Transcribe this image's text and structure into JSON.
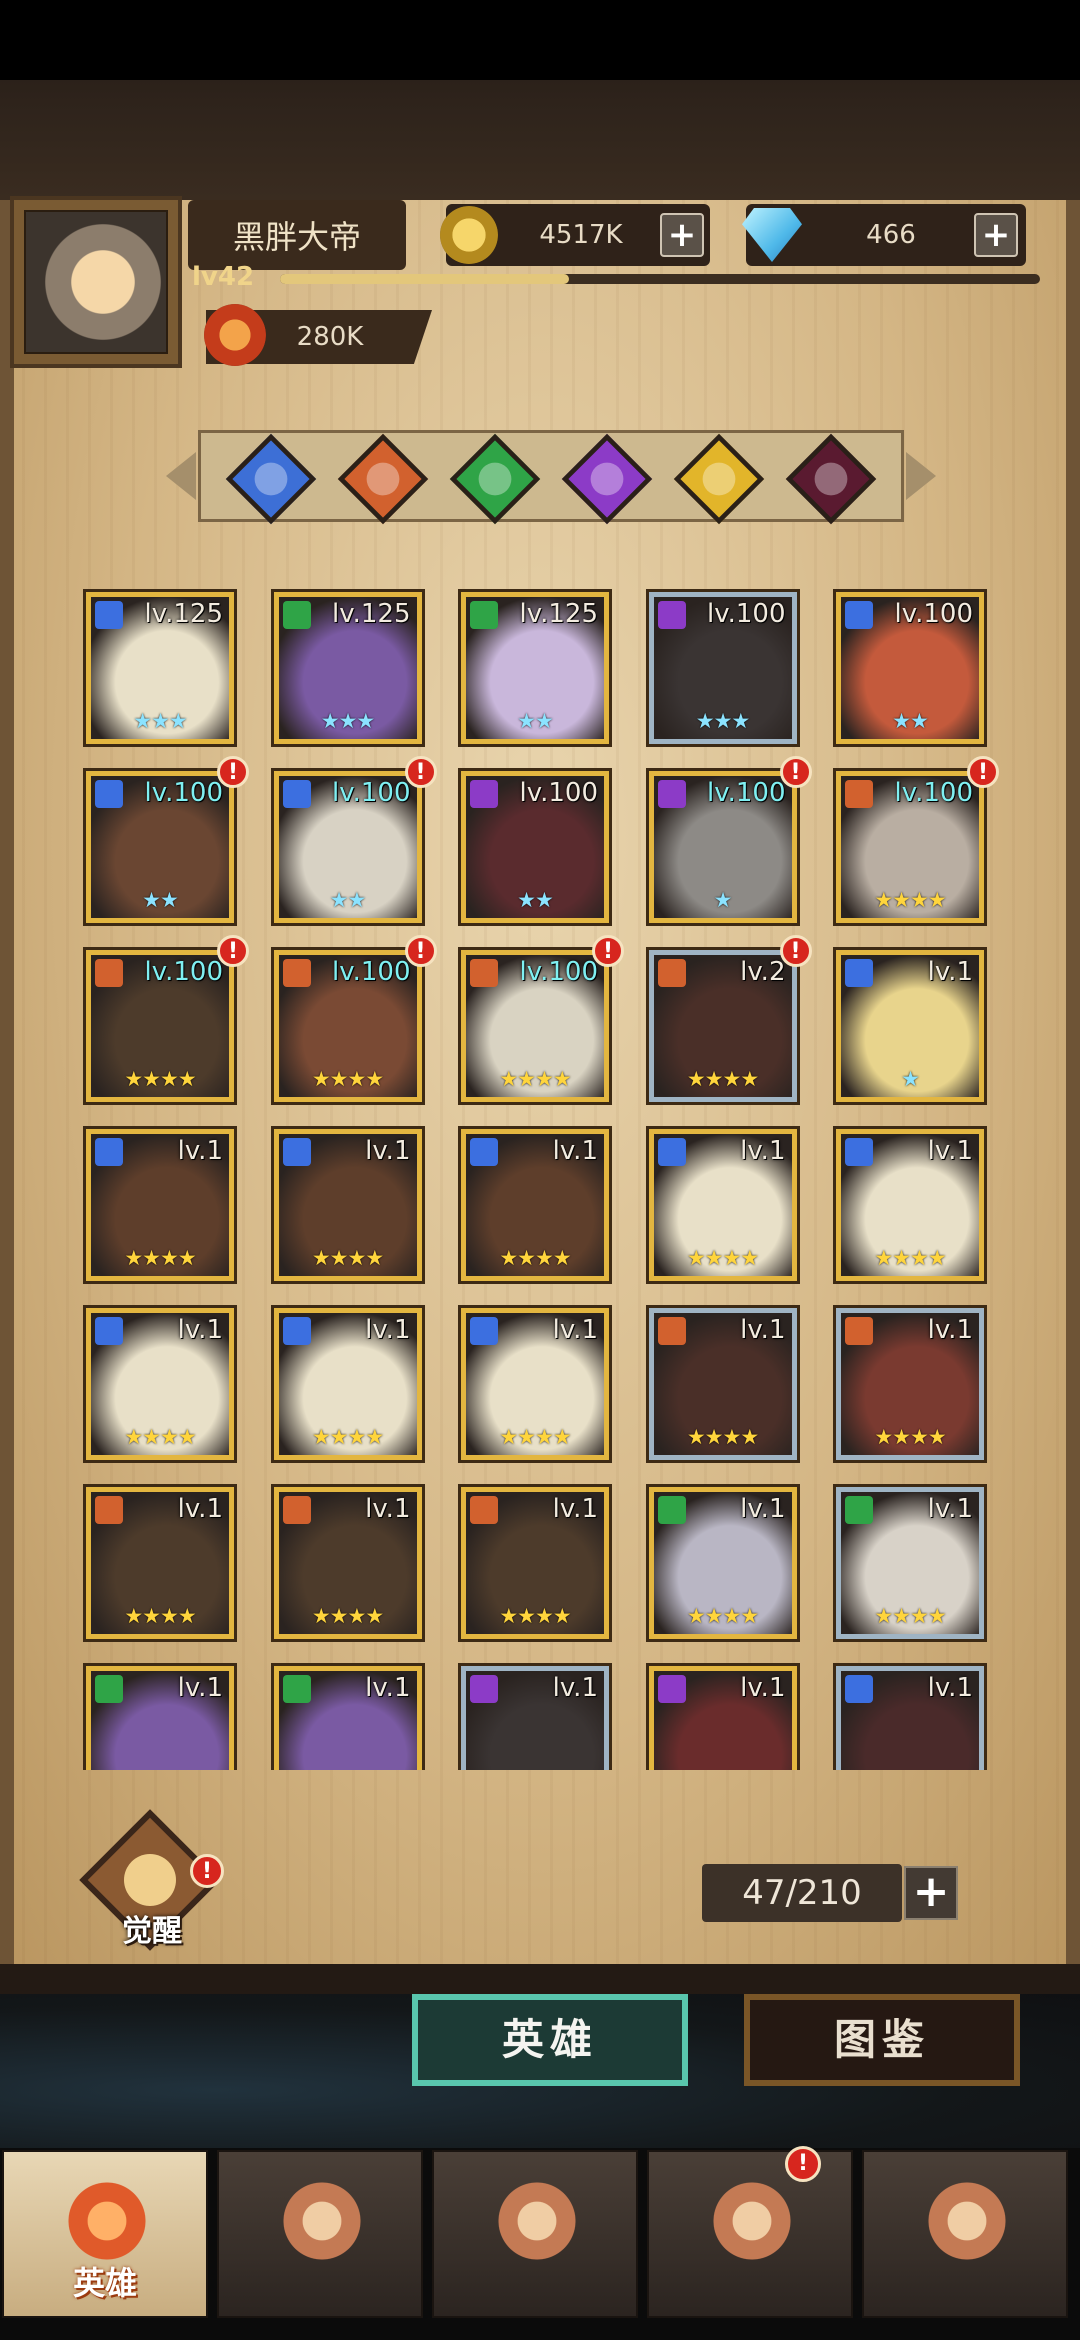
{
  "player": {
    "name": "黑胖大帝",
    "level": "lv42",
    "gold": "4517K",
    "diamonds": "466",
    "power": "280K",
    "xp_progress": 0.38
  },
  "factions": [
    {
      "icon": "faction-light-icon",
      "color": "#3d6fd6"
    },
    {
      "icon": "faction-fire-icon",
      "color": "#d2612e"
    },
    {
      "icon": "faction-nature-icon",
      "color": "#2fa447"
    },
    {
      "icon": "faction-arcane-icon",
      "color": "#8c3bc7"
    },
    {
      "icon": "faction-sun-icon",
      "color": "#e2b52a"
    },
    {
      "icon": "faction-dark-icon",
      "color": "#5a1a30"
    }
  ],
  "heroes": [
    {
      "lv": "lv.125",
      "stars": "★★★",
      "star_color": "blue",
      "frame": "gold",
      "class_color": "#3c6fe0",
      "portrait": "#e8e0c8",
      "capped": false,
      "alert": false
    },
    {
      "lv": "lv.125",
      "stars": "★★★",
      "star_color": "blue",
      "frame": "gold",
      "class_color": "#2fa447",
      "portrait": "#7a5aa3",
      "capped": false,
      "alert": false
    },
    {
      "lv": "lv.125",
      "stars": "★★",
      "star_color": "blue",
      "frame": "gold",
      "class_color": "#2fa447",
      "portrait": "#c9b7db",
      "capped": false,
      "alert": false
    },
    {
      "lv": "lv.100",
      "stars": "★★★",
      "star_color": "blue",
      "frame": "silver",
      "class_color": "#8c3bc7",
      "portrait": "#3a3433",
      "capped": false,
      "alert": false
    },
    {
      "lv": "lv.100",
      "stars": "★★",
      "star_color": "blue",
      "frame": "gold",
      "class_color": "#3c6fe0",
      "portrait": "#c45a3c",
      "capped": false,
      "alert": false
    },
    {
      "lv": "lv.100",
      "stars": "★★",
      "star_color": "blue",
      "frame": "gold",
      "class_color": "#3c6fe0",
      "portrait": "#6a4632",
      "capped": true,
      "alert": true
    },
    {
      "lv": "lv.100",
      "stars": "★★",
      "star_color": "blue",
      "frame": "gold",
      "class_color": "#3c6fe0",
      "portrait": "#d8d2c4",
      "capped": true,
      "alert": true
    },
    {
      "lv": "lv.100",
      "stars": "★★",
      "star_color": "blue",
      "frame": "gold",
      "class_color": "#8c3bc7",
      "portrait": "#5a2b2e",
      "capped": false,
      "alert": false
    },
    {
      "lv": "lv.100",
      "stars": "★",
      "star_color": "blue",
      "frame": "gold",
      "class_color": "#8c3bc7",
      "portrait": "#8d8a86",
      "capped": true,
      "alert": true
    },
    {
      "lv": "lv.100",
      "stars": "★★★★",
      "star_color": "gold",
      "frame": "gold",
      "class_color": "#d2612e",
      "portrait": "#b9aea2",
      "capped": true,
      "alert": true
    },
    {
      "lv": "lv.100",
      "stars": "★★★★",
      "star_color": "gold",
      "frame": "gold",
      "class_color": "#d2612e",
      "portrait": "#4d3b2b",
      "capped": true,
      "alert": true
    },
    {
      "lv": "lv.100",
      "stars": "★★★★",
      "star_color": "gold",
      "frame": "gold",
      "class_color": "#d2612e",
      "portrait": "#7a4a34",
      "capped": true,
      "alert": true
    },
    {
      "lv": "lv.100",
      "stars": "★★★★",
      "star_color": "gold",
      "frame": "gold",
      "class_color": "#d2612e",
      "portrait": "#d9d3c2",
      "capped": true,
      "alert": true
    },
    {
      "lv": "lv.2",
      "stars": "★★★★",
      "star_color": "gold",
      "frame": "silver",
      "class_color": "#d2612e",
      "portrait": "#4a2f28",
      "capped": false,
      "alert": true
    },
    {
      "lv": "lv.1",
      "stars": "★",
      "star_color": "blue",
      "frame": "gold",
      "class_color": "#3c6fe0",
      "portrait": "#e8d48c",
      "capped": false,
      "alert": false
    },
    {
      "lv": "lv.1",
      "stars": "★★★★",
      "star_color": "gold",
      "frame": "gold",
      "class_color": "#3c6fe0",
      "portrait": "#5e3e2b",
      "capped": false,
      "alert": false
    },
    {
      "lv": "lv.1",
      "stars": "★★★★",
      "star_color": "gold",
      "frame": "gold",
      "class_color": "#3c6fe0",
      "portrait": "#5e3e2b",
      "capped": false,
      "alert": false
    },
    {
      "lv": "lv.1",
      "stars": "★★★★",
      "star_color": "gold",
      "frame": "gold",
      "class_color": "#3c6fe0",
      "portrait": "#5e3e2b",
      "capped": false,
      "alert": false
    },
    {
      "lv": "lv.1",
      "stars": "★★★★",
      "star_color": "gold",
      "frame": "gold",
      "class_color": "#3c6fe0",
      "portrait": "#e8e0c8",
      "capped": false,
      "alert": false
    },
    {
      "lv": "lv.1",
      "stars": "★★★★",
      "star_color": "gold",
      "frame": "gold",
      "class_color": "#3c6fe0",
      "portrait": "#e8e0c8",
      "capped": false,
      "alert": false
    },
    {
      "lv": "lv.1",
      "stars": "★★★★",
      "star_color": "gold",
      "frame": "gold",
      "class_color": "#3c6fe0",
      "portrait": "#e8e0c8",
      "capped": false,
      "alert": false
    },
    {
      "lv": "lv.1",
      "stars": "★★★★",
      "star_color": "gold",
      "frame": "gold",
      "class_color": "#3c6fe0",
      "portrait": "#e8e0c8",
      "capped": false,
      "alert": false
    },
    {
      "lv": "lv.1",
      "stars": "★★★★",
      "star_color": "gold",
      "frame": "gold",
      "class_color": "#3c6fe0",
      "portrait": "#e8e0c8",
      "capped": false,
      "alert": false
    },
    {
      "lv": "lv.1",
      "stars": "★★★★",
      "star_color": "gold",
      "frame": "silver",
      "class_color": "#d2612e",
      "portrait": "#4a2f28",
      "capped": false,
      "alert": false
    },
    {
      "lv": "lv.1",
      "stars": "★★★★",
      "star_color": "gold",
      "frame": "silver",
      "class_color": "#d2612e",
      "portrait": "#7a3a30",
      "capped": false,
      "alert": false
    },
    {
      "lv": "lv.1",
      "stars": "★★★★",
      "star_color": "gold",
      "frame": "gold",
      "class_color": "#d2612e",
      "portrait": "#4d3b2b",
      "capped": false,
      "alert": false
    },
    {
      "lv": "lv.1",
      "stars": "★★★★",
      "star_color": "gold",
      "frame": "gold",
      "class_color": "#d2612e",
      "portrait": "#4d3b2b",
      "capped": false,
      "alert": false
    },
    {
      "lv": "lv.1",
      "stars": "★★★★",
      "star_color": "gold",
      "frame": "gold",
      "class_color": "#d2612e",
      "portrait": "#4d3b2b",
      "capped": false,
      "alert": false
    },
    {
      "lv": "lv.1",
      "stars": "★★★★",
      "star_color": "gold",
      "frame": "gold",
      "class_color": "#2fa447",
      "portrait": "#b9b6c4",
      "capped": false,
      "alert": false
    },
    {
      "lv": "lv.1",
      "stars": "★★★★",
      "star_color": "gold",
      "frame": "silver",
      "class_color": "#2fa447",
      "portrait": "#d8d2c8",
      "capped": false,
      "alert": false
    },
    {
      "lv": "lv.1",
      "stars": "",
      "star_color": "gold",
      "frame": "gold",
      "class_color": "#2fa447",
      "portrait": "#7a5aa3",
      "capped": false,
      "alert": false
    },
    {
      "lv": "lv.1",
      "stars": "",
      "star_color": "gold",
      "frame": "gold",
      "class_color": "#2fa447",
      "portrait": "#7a5aa3",
      "capped": false,
      "alert": false
    },
    {
      "lv": "lv.1",
      "stars": "",
      "star_color": "gold",
      "frame": "silver",
      "class_color": "#8c3bc7",
      "portrait": "#3a3433",
      "capped": false,
      "alert": false
    },
    {
      "lv": "lv.1",
      "stars": "",
      "star_color": "gold",
      "frame": "gold",
      "class_color": "#8c3bc7",
      "portrait": "#6a2c2c",
      "capped": false,
      "alert": false
    },
    {
      "lv": "lv.1",
      "stars": "",
      "star_color": "gold",
      "frame": "silver",
      "class_color": "#3c6fe0",
      "portrait": "#4a2a2a",
      "capped": false,
      "alert": false
    }
  ],
  "awaken": {
    "label": "觉醒",
    "alert": "!"
  },
  "hero_count": "47/210",
  "tabs": {
    "heroes": "英雄",
    "codex": "图鉴"
  },
  "nav": [
    {
      "label": "英雄",
      "icon": "hero-helmet-icon",
      "active": true,
      "alert": ""
    },
    {
      "label": "",
      "icon": "expedition-flag-icon",
      "active": false,
      "alert": ""
    },
    {
      "label": "",
      "icon": "battle-swords-icon",
      "active": false,
      "alert": ""
    },
    {
      "label": "",
      "icon": "castle-icon",
      "active": false,
      "alert": "!"
    },
    {
      "label": "",
      "icon": "guild-handshake-icon",
      "active": false,
      "alert": ""
    }
  ]
}
